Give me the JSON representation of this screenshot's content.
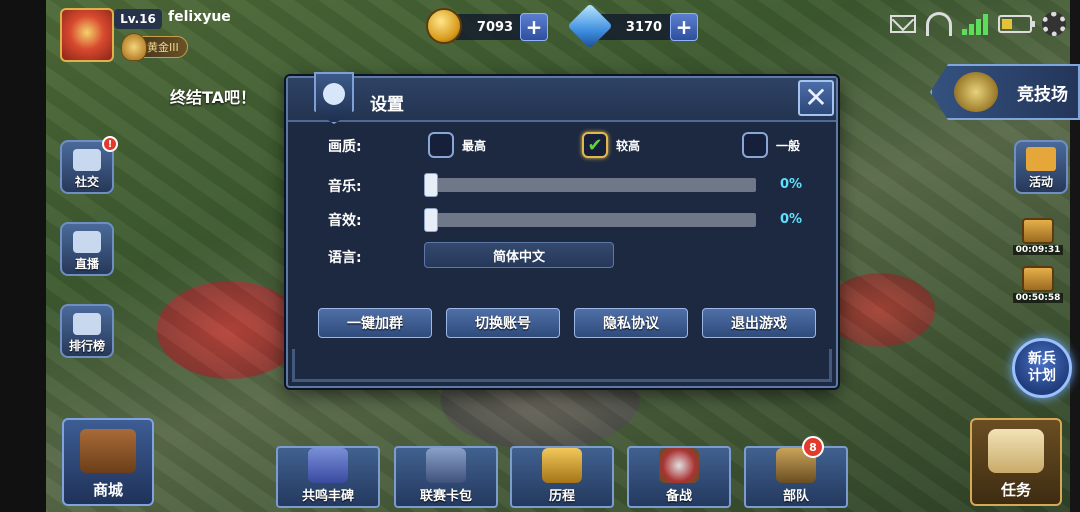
{
  "player": {
    "level": "Lv.16",
    "name": "felixyue",
    "rank": "黄金III"
  },
  "currency": {
    "gold": "7093",
    "gems": "3170"
  },
  "marquee": "终结TA吧！",
  "left_menu": {
    "social": "社交",
    "live": "直播",
    "leaderboard": "排行榜"
  },
  "right_menu": {
    "arena": "竞技场",
    "events": "活动",
    "chest_timers": [
      "00:09:31",
      "00:50:58"
    ],
    "recruit": [
      "新兵",
      "计划"
    ]
  },
  "bottom_nav": {
    "shop": "商城",
    "tasks": "任务",
    "tabs": [
      {
        "label": "共鸣丰碑"
      },
      {
        "label": "联赛卡包"
      },
      {
        "label": "历程"
      },
      {
        "label": "备战"
      },
      {
        "label": "部队",
        "badge": "8"
      }
    ]
  },
  "settings": {
    "title": "设置",
    "quality_label": "画质:",
    "quality_options": [
      {
        "label": "最高",
        "checked": false
      },
      {
        "label": "较高",
        "checked": true
      },
      {
        "label": "一般",
        "checked": false
      }
    ],
    "music_label": "音乐:",
    "music_value": "0%",
    "sfx_label": "音效:",
    "sfx_value": "0%",
    "language_label": "语言:",
    "language_value": "简体中文",
    "actions": [
      "一键加群",
      "切换账号",
      "隐私协议",
      "退出游戏"
    ]
  },
  "colors": {
    "dialog_bg": "#1d2940",
    "accent_blue": "#4f6fa6",
    "percent_cyan": "#5fe0ff",
    "badge_red": "#e23b2e"
  }
}
